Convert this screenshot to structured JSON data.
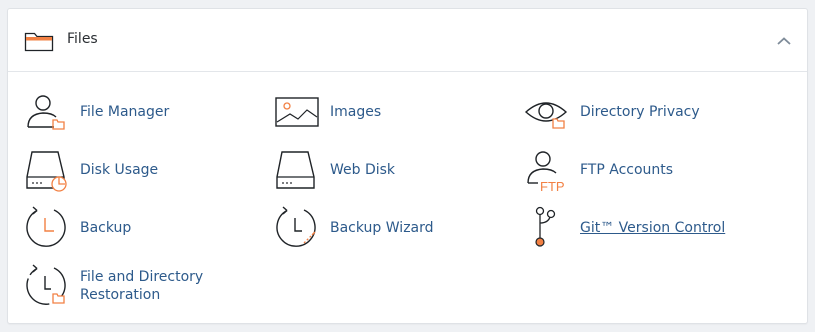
{
  "section": {
    "title": "Files",
    "collapse_icon": "chevron-up-icon"
  },
  "colors": {
    "accent": "#f28043",
    "link": "#2d5a8b",
    "icon_stroke": "#1f2327"
  },
  "items": [
    {
      "label": "File Manager",
      "icon": "file-manager-icon"
    },
    {
      "label": "Images",
      "icon": "images-icon"
    },
    {
      "label": "Directory Privacy",
      "icon": "directory-privacy-icon"
    },
    {
      "label": "Disk Usage",
      "icon": "disk-usage-icon"
    },
    {
      "label": "Web Disk",
      "icon": "web-disk-icon"
    },
    {
      "label": "FTP Accounts",
      "icon": "ftp-accounts-icon"
    },
    {
      "label": "Backup",
      "icon": "backup-icon"
    },
    {
      "label": "Backup Wizard",
      "icon": "backup-wizard-icon"
    },
    {
      "label": "Git™ Version Control",
      "icon": "git-version-control-icon"
    },
    {
      "label_line1": "File and Directory",
      "label_line2": "Restoration",
      "icon": "file-directory-restoration-icon"
    }
  ]
}
